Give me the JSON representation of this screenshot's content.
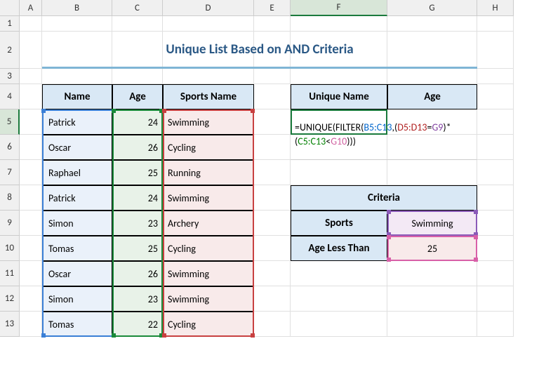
{
  "columns": [
    "A",
    "B",
    "C",
    "D",
    "E",
    "F",
    "G",
    "H"
  ],
  "rows": [
    "1",
    "2",
    "3",
    "4",
    "5",
    "6",
    "7",
    "8",
    "9",
    "10",
    "11",
    "12",
    "13"
  ],
  "title": "Unique List Based on AND Criteria",
  "table": {
    "headers": {
      "name": "Name",
      "age": "Age",
      "sport": "Sports Name"
    },
    "rows": [
      {
        "name": "Patrick",
        "age": "24",
        "sport": "Swimming"
      },
      {
        "name": "Oscar",
        "age": "26",
        "sport": "Cycling"
      },
      {
        "name": "Raphael",
        "age": "25",
        "sport": "Running"
      },
      {
        "name": "Patrick",
        "age": "24",
        "sport": "Swimming"
      },
      {
        "name": "Simon",
        "age": "23",
        "sport": "Archery"
      },
      {
        "name": "Tomas",
        "age": "25",
        "sport": "Cycling"
      },
      {
        "name": "Oscar",
        "age": "26",
        "sport": "Swimming"
      },
      {
        "name": "Simon",
        "age": "23",
        "sport": "Swimming"
      },
      {
        "name": "Tomas",
        "age": "22",
        "sport": "Cycling"
      }
    ]
  },
  "result_headers": {
    "unique_name": "Unique Name",
    "age": "Age"
  },
  "formula": {
    "p1": "=UNIQUE(FILTER(",
    "r1": "B5:C13",
    "p2": ",(",
    "r2": "D5:D13",
    "p3": "=",
    "r3": "G9",
    "p4": ")*",
    "p5": "(",
    "r4": "C5:C13",
    "p6": "<",
    "r5": "G10",
    "p7": ")))"
  },
  "criteria": {
    "title": "Criteria",
    "sports_label": "Sports",
    "sports_value": "Swimming",
    "age_label": "Age Less Than",
    "age_value": "25"
  }
}
